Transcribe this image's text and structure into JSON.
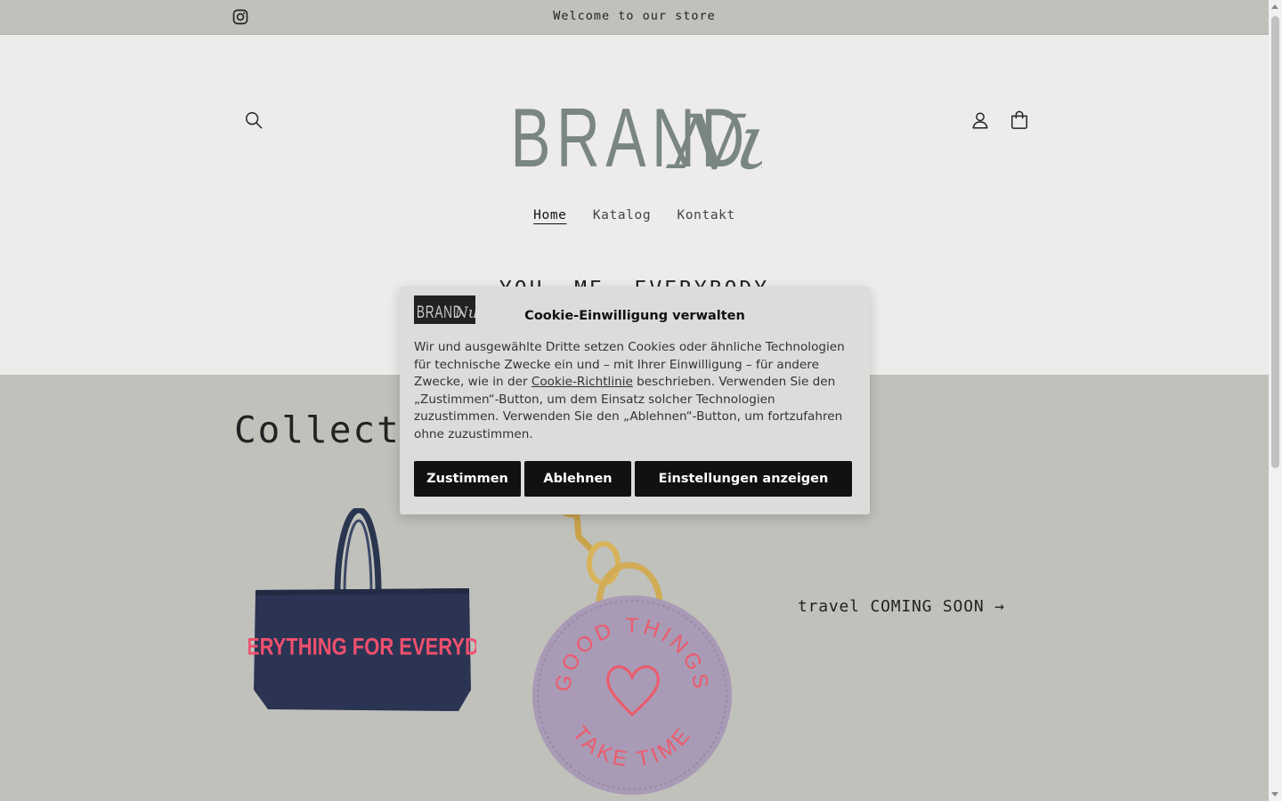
{
  "announcement": {
    "text": "Welcome to our store",
    "social_icon": "instagram-icon"
  },
  "header": {
    "logo_text": "BRAND",
    "logo_script": "Nu",
    "icons": [
      "search-icon",
      "account-icon",
      "cart-icon"
    ],
    "logo_color": "#7a8680"
  },
  "nav": {
    "items": [
      "Home",
      "Katalog",
      "Kontakt"
    ],
    "active": "Home"
  },
  "tagline": "YOU. ME. EVERYBODY",
  "collections": {
    "heading": "Collections",
    "travel_link": "travel COMING SOON →",
    "bag_print": "EVERYTHING FOR EVERYDAY",
    "keychain_top": "GOOD THINGS",
    "keychain_bottom": "TAKE TIME"
  },
  "cookie": {
    "title": "Cookie-Einwilligung verwalten",
    "text_before_link": "Wir und ausgewählte Dritte setzen Cookies oder ähnliche Technologien für technische Zwecke ein und – mit Ihrer Einwilligung – für andere Zwecke, wie in der ",
    "link": "Cookie-Richtlinie",
    "text_after_link": " beschrieben. Verwenden Sie den „Zustimmen“-Button, um dem Einsatz solcher Technologien zuzustimmen. Verwenden Sie den „Ablehnen“-Button, um fortzufahren ohne zuzustimmen.",
    "buttons": {
      "accept": "Zustimmen",
      "decline": "Ablehnen",
      "settings": "Einstellungen anzeigen"
    }
  },
  "colors": {
    "background": "#edecea",
    "band": "#c0c1bb",
    "button": "#111111",
    "accent_pink": "#f0506e"
  }
}
